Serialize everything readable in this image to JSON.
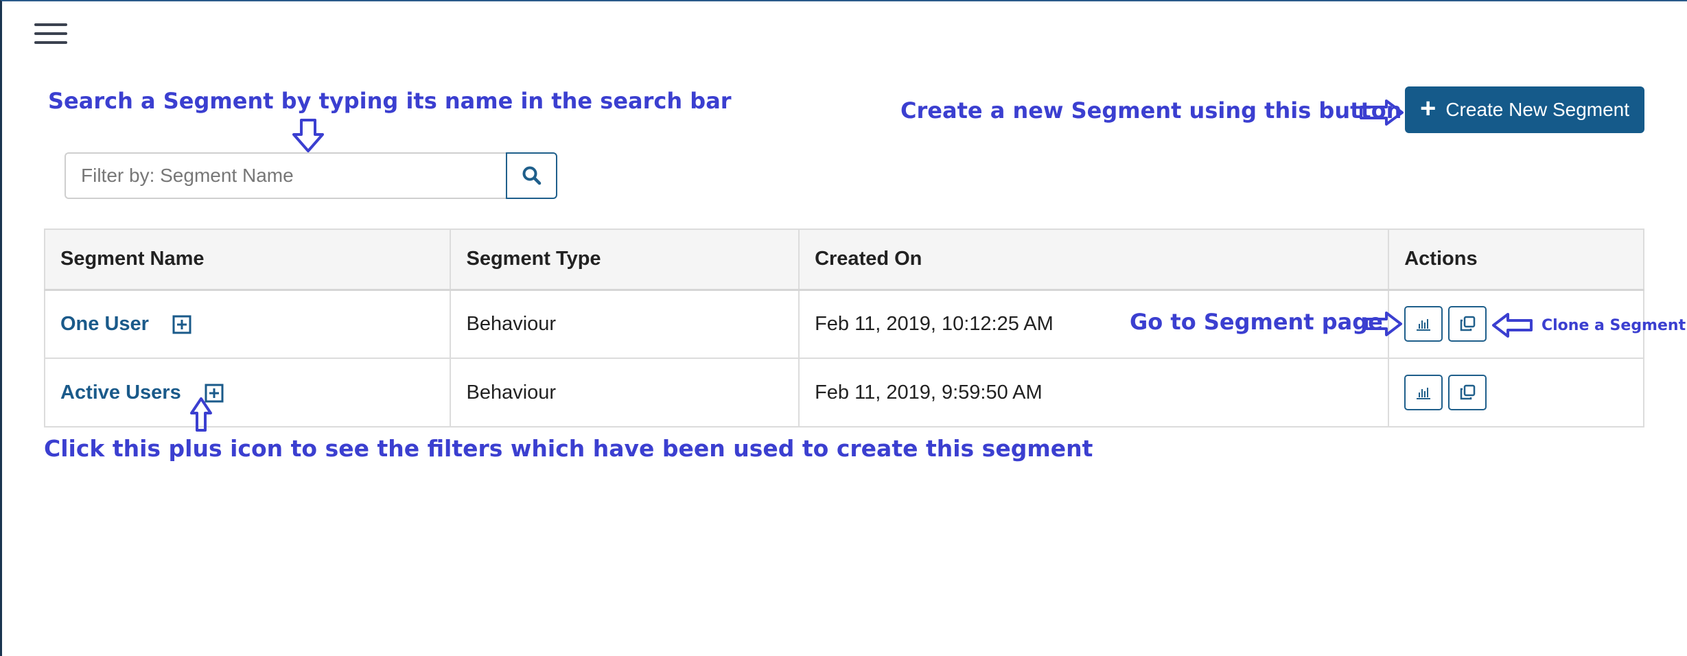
{
  "annotations": {
    "search_hint": "Search a Segment by typing its name in the search bar",
    "create_hint": "Create a new Segment using this button",
    "goto_hint": "Go to Segment page",
    "clone_hint": "Clone a Segment",
    "plus_hint": "Click this plus icon to see the filters which have been used to create this segment"
  },
  "search": {
    "placeholder": "Filter by: Segment Name",
    "value": ""
  },
  "create_button": {
    "label": "Create New Segment"
  },
  "table": {
    "headers": [
      "Segment Name",
      "Segment Type",
      "Created On",
      "Actions"
    ],
    "rows": [
      {
        "name": "One User",
        "type": "Behaviour",
        "created_on": "Feb 11, 2019, 10:12:25 AM"
      },
      {
        "name": "Active Users",
        "type": "Behaviour",
        "created_on": "Feb 11, 2019, 9:59:50 AM"
      }
    ]
  },
  "colors": {
    "primary": "#155a8a",
    "annotation": "#3b3fd0",
    "header_bg": "#f5f5f5"
  },
  "icons": {
    "menu": "hamburger-icon",
    "search": "search-icon",
    "expand": "plus-square-icon",
    "analytics": "bar-chart-icon",
    "clone": "copy-icon"
  }
}
